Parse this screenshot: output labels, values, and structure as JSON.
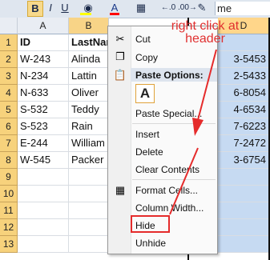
{
  "ribbon": {
    "bold": "B",
    "italic": "I",
    "underline": "U",
    "font_color": "A",
    "decimal_increase": "←.0",
    "decimal_decrease": ".00→",
    "namebox_value": "me"
  },
  "columns": [
    "A",
    "B",
    "D"
  ],
  "rows": [
    "1",
    "2",
    "3",
    "4",
    "5",
    "6",
    "7",
    "8",
    "9",
    "10",
    "11",
    "12",
    "13"
  ],
  "table": {
    "headers": [
      "ID",
      "LastNar"
    ],
    "records": [
      {
        "id": "W-243",
        "last": "Alinda",
        "phone": "3-5453"
      },
      {
        "id": "N-234",
        "last": "Lattin",
        "phone": "2-5433"
      },
      {
        "id": "N-633",
        "last": "Oliver",
        "phone": "6-8054"
      },
      {
        "id": "S-532",
        "last": "Teddy",
        "phone": "4-6534"
      },
      {
        "id": "S-523",
        "last": "Rain",
        "phone": "7-6223"
      },
      {
        "id": "E-244",
        "last": "William",
        "phone": "7-2472"
      },
      {
        "id": "W-545",
        "last": "Packer",
        "phone": "3-6754"
      }
    ]
  },
  "context_menu": {
    "cut": "Cut",
    "copy": "Copy",
    "paste_options": "Paste Options:",
    "paste_a": "A",
    "paste_special": "Paste Special...",
    "insert": "Insert",
    "delete": "Delete",
    "clear_contents": "Clear Contents",
    "format_cells": "Format Cells...",
    "column_width": "Column Width...",
    "hide": "Hide",
    "unhide": "Unhide"
  },
  "annotation": {
    "text": "right click at header",
    "color": "#e03030"
  },
  "colors": {
    "selected_header": "#f8d487",
    "selected_column": "#c6daf2",
    "highlight_box": "#e52b2b"
  }
}
